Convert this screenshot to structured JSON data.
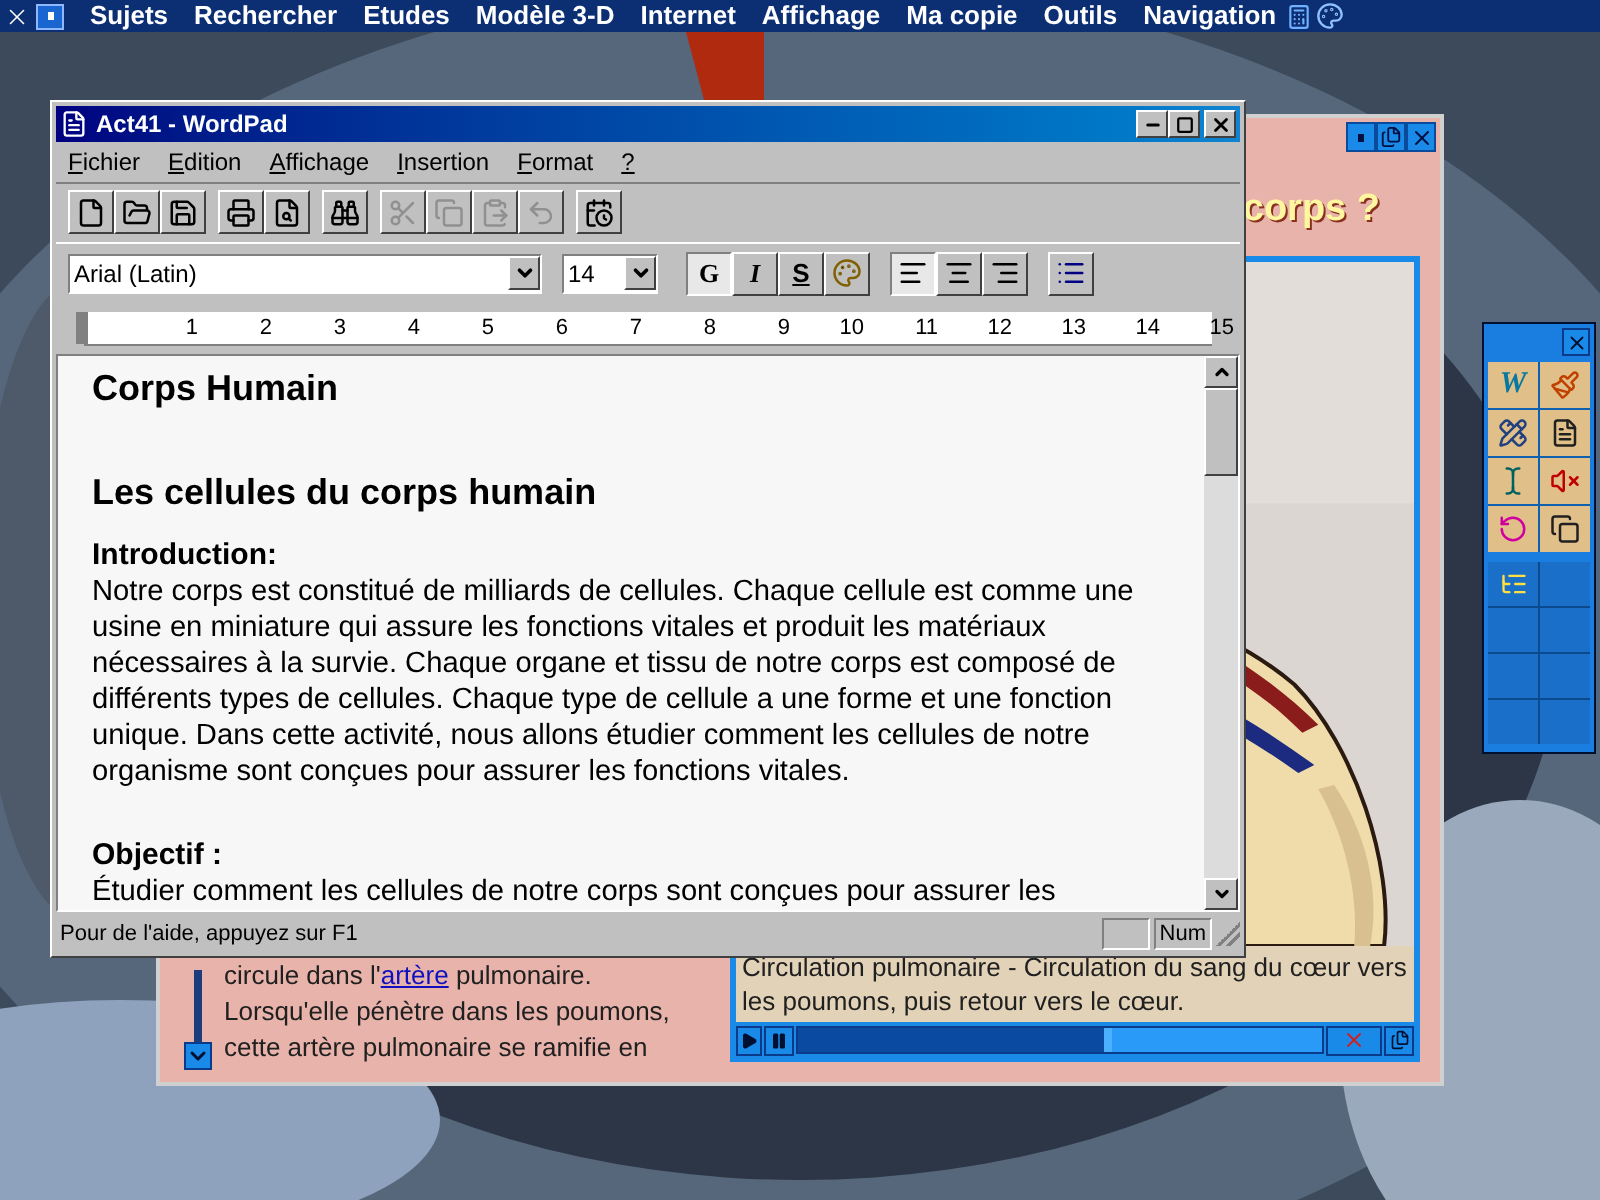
{
  "top_menu": {
    "items": [
      "Sujets",
      "Rechercher",
      "Etudes",
      "Modèle 3-D",
      "Internet",
      "Affichage",
      "Ma copie",
      "Outils",
      "Navigation"
    ]
  },
  "lesson_window": {
    "heading": "corps ?",
    "lines": [
      {
        "parts": [
          {
            "kind": "text",
            "text": "circule dans l'"
          },
          {
            "kind": "link",
            "text": "artère"
          },
          {
            "kind": "text",
            "text": " pulmonaire."
          }
        ]
      },
      {
        "parts": [
          {
            "kind": "text",
            "text": "Lorsqu'elle pénètre dans les poumons,"
          }
        ]
      },
      {
        "parts": [
          {
            "kind": "text",
            "text": "cette artère pulmonaire se ramifie en"
          }
        ]
      }
    ],
    "caption": "Circulation pulmonaire - Circulation du sang du cœur vers les poumons, puis retour vers le cœur.",
    "player": {
      "level": 0.6
    }
  },
  "wordpad": {
    "title": "Act41 - WordPad",
    "menu": [
      "Fichier",
      "Edition",
      "Affichage",
      "Insertion",
      "Format",
      "?"
    ],
    "toolbar": [
      [
        {
          "kind": "new",
          "disabled": false
        },
        {
          "kind": "open",
          "disabled": false
        },
        {
          "kind": "save",
          "disabled": false
        }
      ],
      [
        {
          "kind": "print",
          "disabled": false
        },
        {
          "kind": "preview",
          "disabled": false
        }
      ],
      [
        {
          "kind": "find",
          "disabled": false
        }
      ],
      [
        {
          "kind": "cut",
          "disabled": true
        },
        {
          "kind": "copy",
          "disabled": true
        },
        {
          "kind": "paste",
          "disabled": true
        },
        {
          "kind": "undo",
          "disabled": true
        }
      ],
      [
        {
          "kind": "datetime",
          "disabled": false
        }
      ]
    ],
    "font": "Arial (Latin)",
    "size": "14",
    "style_buttons": [
      {
        "kind": "bold",
        "label": "G",
        "selected": true
      },
      {
        "kind": "italic",
        "label": "I",
        "selected": false
      },
      {
        "kind": "underline",
        "label": "S",
        "selected": false
      },
      {
        "kind": "color",
        "selected": false
      }
    ],
    "align_buttons": [
      {
        "kind": "left",
        "selected": true
      },
      {
        "kind": "center",
        "selected": false
      },
      {
        "kind": "right",
        "selected": false
      }
    ],
    "ruler": [
      "1",
      "2",
      "3",
      "4",
      "5",
      "6",
      "7",
      "8",
      "9",
      "10",
      "11",
      "12",
      "13",
      "14",
      "15"
    ],
    "document": [
      {
        "kind": "title",
        "text": "Corps Humain"
      },
      {
        "kind": "heading",
        "text": "Les cellules du corps humain"
      },
      {
        "kind": "subheading",
        "text": "Introduction:"
      },
      {
        "kind": "paragraph",
        "text": "Notre corps est constitué de milliards de cellules. Chaque cellule est comme une usine en miniature qui assure les fonctions vitales et produit les matériaux nécessaires à la survie. Chaque organe et tissu de notre corps est composé de différents types de cellules. Chaque type de cellule a une forme et une fonction unique. Dans cette activité, nous allons étudier comment les cellules de notre organisme sont conçues pour assurer les fonctions vitales."
      },
      {
        "kind": "subheading",
        "text": "Objectif :"
      },
      {
        "kind": "paragraph",
        "text": "Étudier comment les cellules de notre corps sont conçues pour assurer les"
      }
    ],
    "status": "Pour de l'aide, appuyez sur F1",
    "num": "Num"
  },
  "toolbox": {
    "tools": [
      {
        "kind": "word",
        "label": "W"
      },
      {
        "kind": "brush"
      },
      {
        "kind": "pencils"
      },
      {
        "kind": "document"
      },
      {
        "kind": "cursor"
      },
      {
        "kind": "mute"
      },
      {
        "kind": "reset"
      },
      {
        "kind": "copy"
      }
    ],
    "slots": [
      {
        "kind": "outline"
      },
      {
        "kind": "empty"
      },
      {
        "kind": "empty"
      },
      {
        "kind": "empty"
      },
      {
        "kind": "empty"
      },
      {
        "kind": "empty"
      },
      {
        "kind": "empty"
      },
      {
        "kind": "empty"
      }
    ]
  }
}
